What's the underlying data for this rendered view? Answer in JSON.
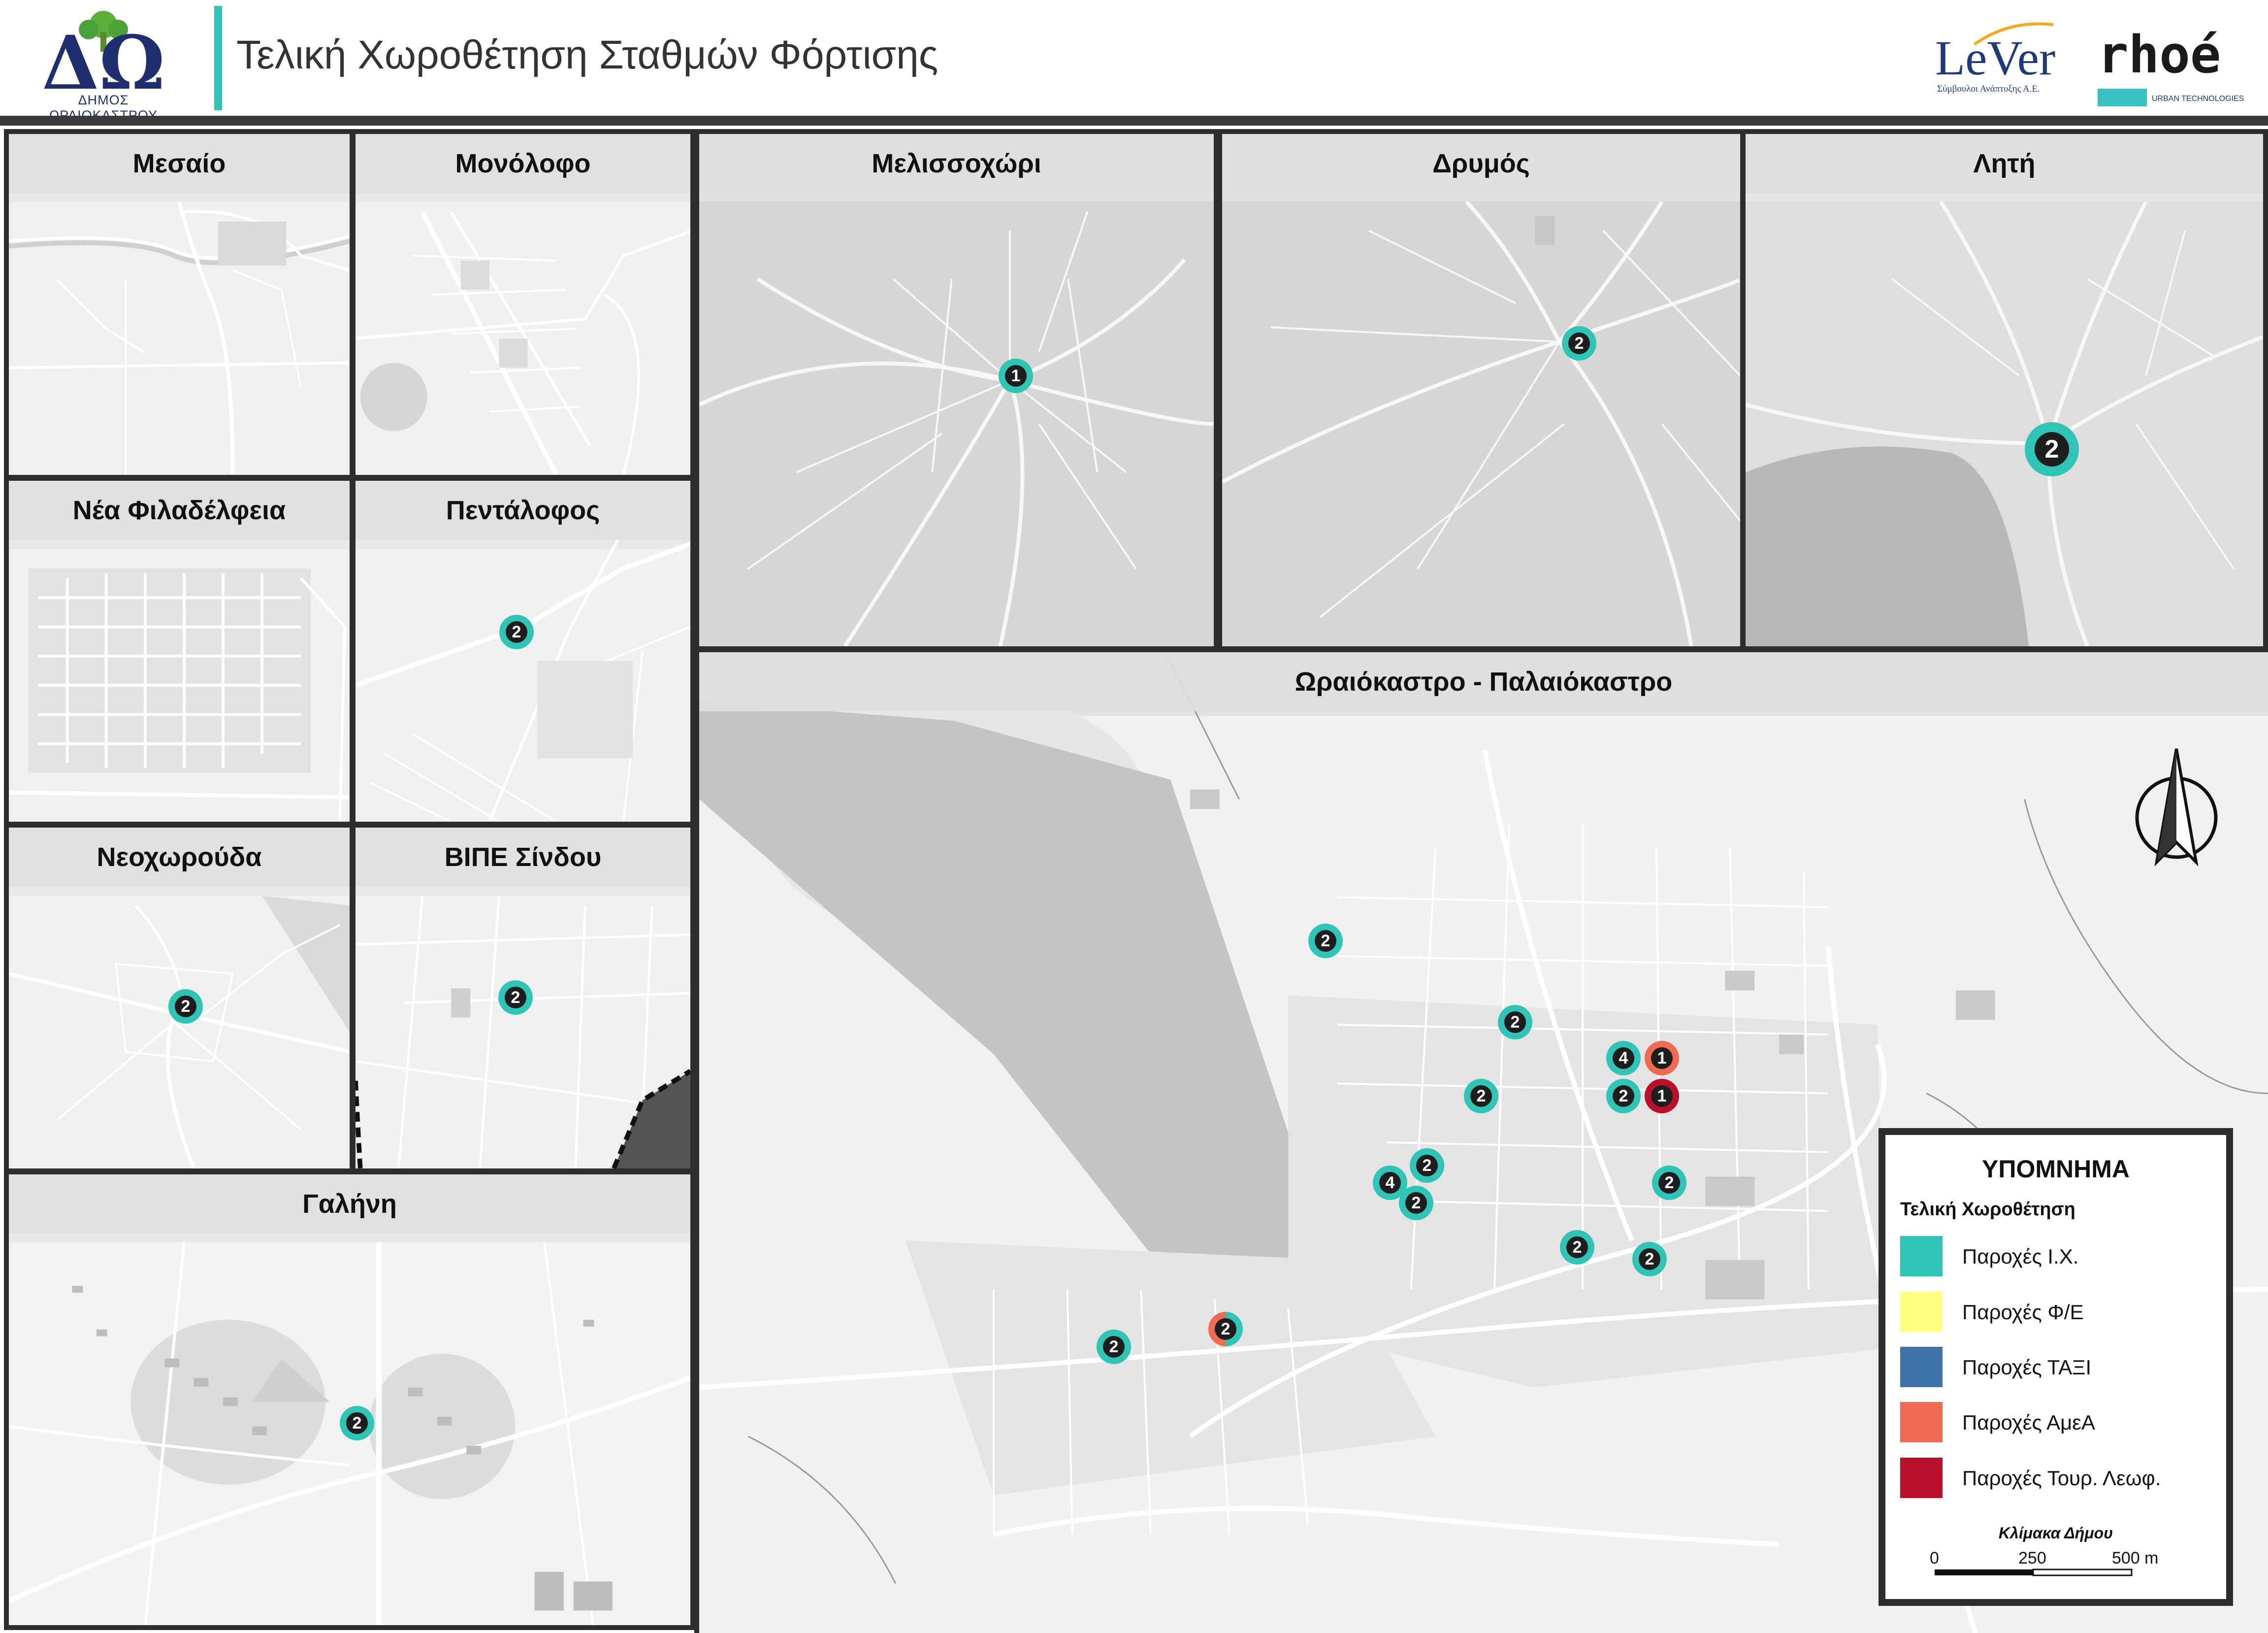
{
  "header": {
    "title": "Τελική Χωροθέτηση Σταθμών Φόρτισης",
    "municipality_logo_caption": "ΔΗΜΟΣ ΩΡΑΙΟΚΑΣΤΡΟΥ",
    "municipality_logo_letters": "ΔΩ",
    "partner_logo_1": "LeVer",
    "partner_logo_1_sub": "Σύμβουλοι Ανάπτυξης Α.Ε.",
    "partner_logo_2": "rhoé",
    "partner_logo_2_sub": "URBAN TECHNOLOGIES"
  },
  "colors": {
    "teal_ix": "#2fc4b6",
    "yellow_fe": "#ffff80",
    "blue_taxi": "#3f72a8",
    "coral_amea": "#ee6a52",
    "crimson_tour": "#b8102a",
    "marker_center": "#1e1e1e",
    "frame": "#2e2e2e"
  },
  "panels": {
    "mesaio": {
      "title": "Μεσαίο",
      "markers": []
    },
    "monolofo": {
      "title": "Μονόλοφο",
      "markers": []
    },
    "melissochori": {
      "title": "Μελισσοχώρι",
      "markers": [
        {
          "count": "1",
          "type": "ix"
        }
      ]
    },
    "drymos": {
      "title": "Δρυμός",
      "markers": [
        {
          "count": "2",
          "type": "ix"
        }
      ]
    },
    "liti": {
      "title": "Λητή",
      "markers": [
        {
          "count": "2",
          "type": "ix"
        }
      ]
    },
    "nea_filadelfeia": {
      "title": "Νέα Φιλαδέλφεια",
      "markers": []
    },
    "pentalofos": {
      "title": "Πεντάλοφος",
      "markers": [
        {
          "count": "2",
          "type": "ix"
        }
      ]
    },
    "neochorouda": {
      "title": "Νεοχωρούδα",
      "markers": [
        {
          "count": "2",
          "type": "ix"
        }
      ]
    },
    "vipe_sindou": {
      "title": "ΒΙΠΕ Σίνδου",
      "markers": [
        {
          "count": "2",
          "type": "ix"
        }
      ]
    },
    "galini": {
      "title": "Γαλήνη",
      "markers": [
        {
          "count": "2",
          "type": "ix"
        }
      ]
    },
    "oraiokastro": {
      "title": "Ωραιόκαστρο - Παλαιόκαστρο",
      "markers": [
        {
          "count": "2",
          "type": "ix"
        },
        {
          "count": "2",
          "type": "ix"
        },
        {
          "count": "4",
          "type": "ix"
        },
        {
          "count": "1",
          "type": "amea"
        },
        {
          "count": "2",
          "type": "ix"
        },
        {
          "count": "1",
          "type": "tour"
        },
        {
          "count": "2",
          "type": "ix"
        },
        {
          "count": "2",
          "type": "ix"
        },
        {
          "count": "4",
          "type": "ix"
        },
        {
          "count": "2",
          "type": "ix"
        },
        {
          "count": "2",
          "type": "ix"
        },
        {
          "count": "2",
          "type": "ix"
        },
        {
          "count": "2",
          "type": "ix"
        },
        {
          "count": "2",
          "type": "amea+ix"
        },
        {
          "count": "2",
          "type": "ix"
        }
      ]
    }
  },
  "legend": {
    "title": "ΥΠΟΜΝΗΜΑ",
    "subtitle": "Τελική Χωροθέτηση",
    "items": [
      {
        "label": "Παροχές Ι.Χ.",
        "color": "#2fc4b6"
      },
      {
        "label": "Παροχές Φ/Ε",
        "color": "#ffff80"
      },
      {
        "label": "Παροχές ΤΑΞΙ",
        "color": "#3f72a8"
      },
      {
        "label": "Παροχές ΑμεΑ",
        "color": "#ee6a52"
      },
      {
        "label": "Παροχές Τουρ. Λεωφ.",
        "color": "#b8102a"
      }
    ],
    "scale_title": "Κλίμακα Δήμου",
    "scale_labels": [
      "0",
      "250",
      "500 m"
    ]
  },
  "north_arrow_icon": "north-arrow-icon"
}
